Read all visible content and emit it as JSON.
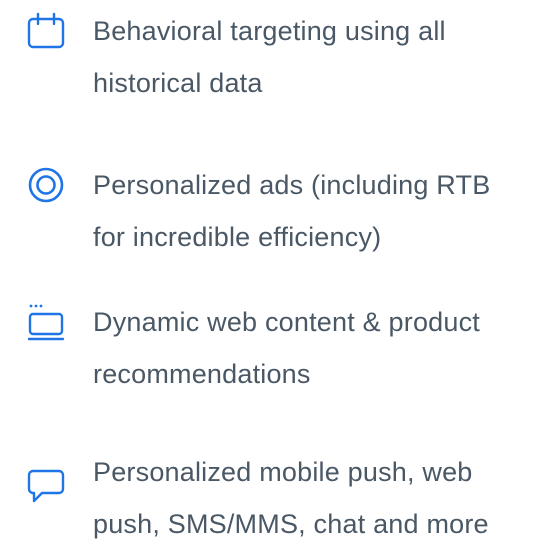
{
  "accent_color": "#1f74e6",
  "text_color": "#4a5866",
  "features": [
    {
      "icon": "calendar-icon",
      "lines": [
        "Behavioral targeting using all",
        "historical data"
      ]
    },
    {
      "icon": "target-icon",
      "lines": [
        "Personalized ads (including RTB",
        "for incredible efficiency)"
      ]
    },
    {
      "icon": "browser-window-icon",
      "lines": [
        "Dynamic web content & product",
        "recommendations"
      ]
    },
    {
      "icon": "chat-bubble-icon",
      "lines": [
        "Personalized mobile push, web",
        "push, SMS/MMS, chat and more"
      ]
    }
  ]
}
